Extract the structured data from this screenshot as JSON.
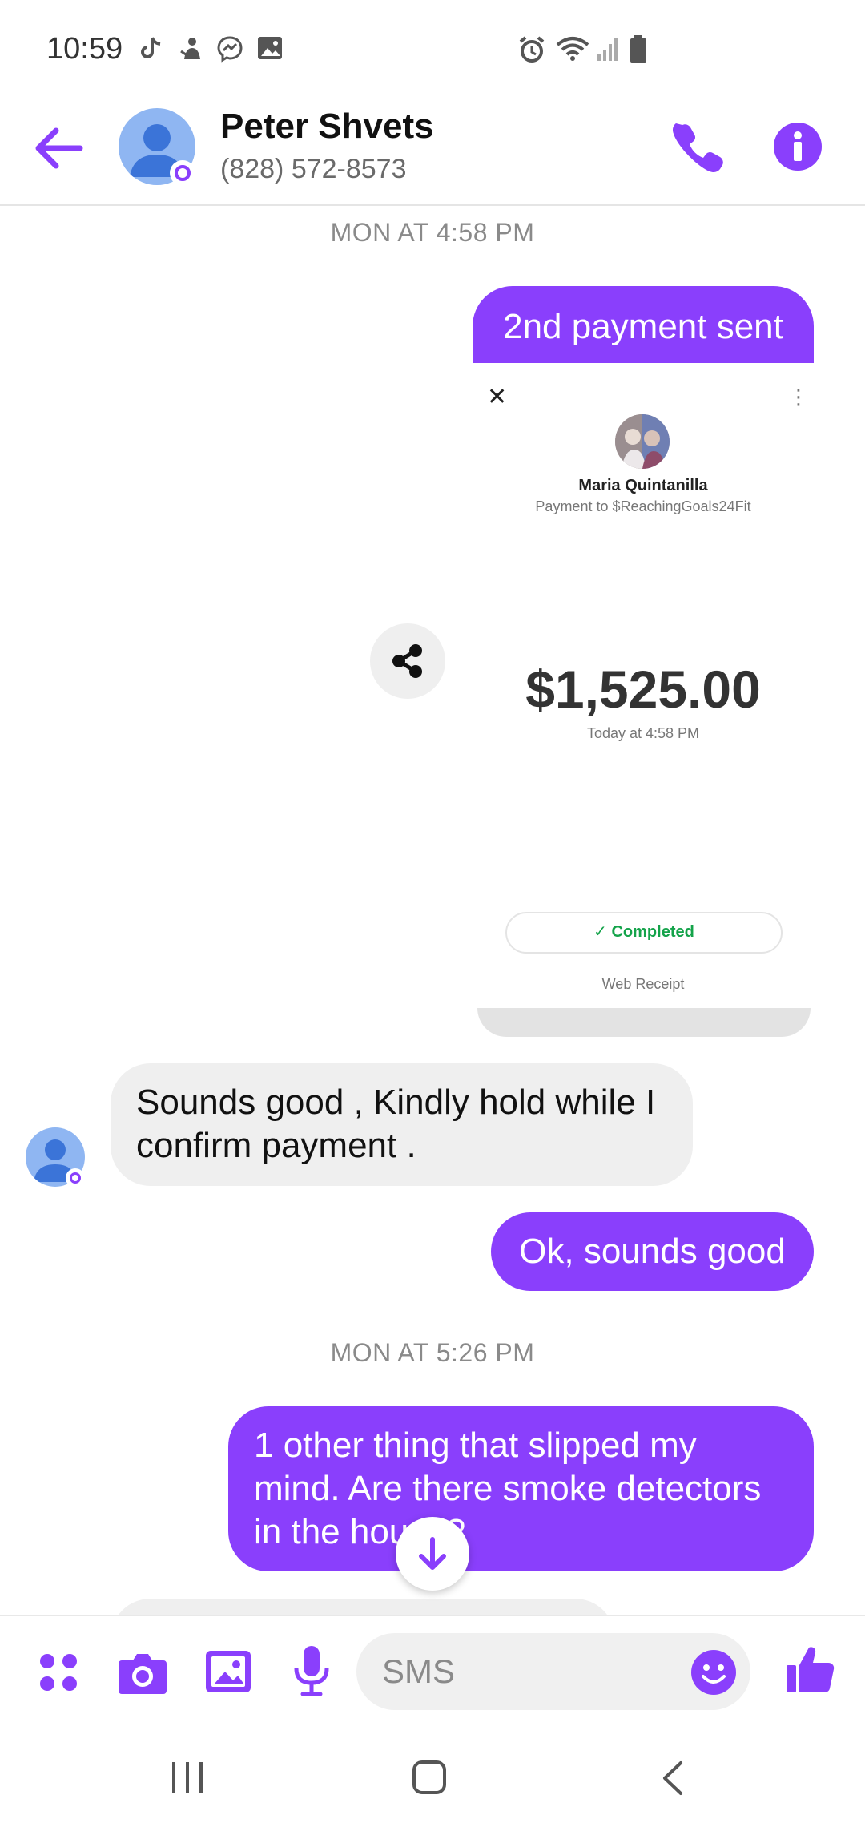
{
  "status_bar": {
    "time": "10:59"
  },
  "header": {
    "contact_name": "Peter Shvets",
    "contact_phone": "(828) 572-8573"
  },
  "conversation": {
    "timestamp_1": "MON AT 4:58 PM",
    "msg_out_1": "2nd payment sent",
    "receipt": {
      "close_glyph": "✕",
      "more_glyph": "⋮",
      "recipient_name": "Maria Quintanilla",
      "payment_to": "Payment to $ReachingGoals24Fit",
      "amount": "$1,525.00",
      "date": "Today at 4:58 PM",
      "status": "✓ Completed",
      "web_receipt": "Web Receipt"
    },
    "msg_in_1_line1": "Sounds good , Kindly hold while I",
    "msg_in_1_line2": "confirm payment .",
    "msg_out_2": "Ok, sounds good",
    "timestamp_2": "MON AT 5:26 PM",
    "msg_out_3_line1": "1 other thing that slipped my",
    "msg_out_3_line2": "mind. Are there smoke detectors",
    "msg_out_3_line3": "in the house?"
  },
  "composer": {
    "placeholder": "SMS"
  },
  "colors": {
    "accent": "#8a3ffc",
    "incoming_bubble": "#efefef",
    "completed_green": "#14a34a"
  },
  "icons": [
    "tiktok-icon",
    "notification-icon",
    "messenger-icon",
    "gallery-icon",
    "alarm-icon",
    "wifi-icon",
    "signal-icon",
    "battery-icon",
    "back-arrow-icon",
    "phone-icon",
    "info-icon",
    "share-icon",
    "arrow-down-icon",
    "apps-icon",
    "camera-icon",
    "image-icon",
    "microphone-icon",
    "emoji-icon",
    "thumbs-up-icon",
    "recent-apps-icon",
    "home-icon",
    "nav-back-icon"
  ]
}
